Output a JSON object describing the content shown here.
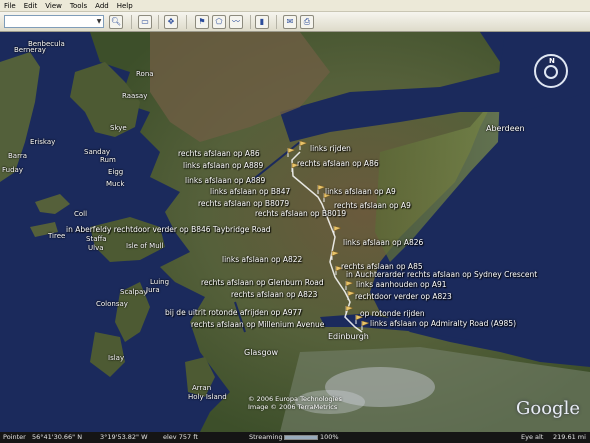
{
  "menu": [
    "File",
    "Edit",
    "View",
    "Tools",
    "Add",
    "Help"
  ],
  "search": {
    "value": "",
    "placeholder": ""
  },
  "map": {
    "places": [
      "Benbecula",
      "Rona",
      "Raasay",
      "Skye",
      "Barra",
      "Sanday",
      "Rum",
      "Eigg",
      "Muck",
      "Coll",
      "Tiree",
      "Staffa",
      "Ulva",
      "Isle of Mull",
      "Colonsay",
      "Scalpay",
      "Jura",
      "Islay",
      "Arran",
      "Holy Island",
      "Berneray",
      "Eriskay",
      "Fuday",
      "Luing"
    ],
    "cities": [
      "Aberdeen",
      "Glasgow",
      "Edinburgh"
    ],
    "directions": [
      "links rijden",
      "rechts afslaan op A86",
      "links afslaan op A889",
      "rechts afslaan op A86",
      "links afslaan op A889",
      "links afslaan op B847",
      "links afslaan op A9",
      "rechts afslaan op B8079",
      "rechts afslaan op A9",
      "rechts afslaan op B8019",
      "in Aberfeldy rechtdoor verder op B846 Taybridge Road",
      "links afslaan op A826",
      "links afslaan op A822",
      "rechts afslaan op A85",
      "in Auchterarder rechts afslaan op Sydney Crescent",
      "rechts afslaan op Glenburn Road",
      "links aanhouden op A91",
      "rechts afslaan op A823",
      "rechtdoor verder op A823",
      "bij de uitrit rotonde afrijden op A977",
      "op rotonde rijden",
      "rechts afslaan op Millenium Avenue",
      "links afslaan op Admiralty Road (A985)"
    ],
    "copyright": [
      "© 2006 Europa Technologies",
      "Image © 2006 TerraMetrics"
    ],
    "logo": "Google",
    "streaming_progress": 1.0
  },
  "status": {
    "pointer_label": "Pointer",
    "pointer_lat": "56°41'30.66\" N",
    "pointer_lon": "3°19'53.82\" W",
    "elev": "elev  757 ft",
    "streaming_label": "Streaming",
    "streaming_pct": "100%",
    "eye_label": "Eye alt",
    "eye_alt": "219.61 mi"
  },
  "colors": {
    "sea": "#1b2a5c",
    "land": "#4a5a2e",
    "highland": "#6b5a3e",
    "route": "#ffffff"
  }
}
